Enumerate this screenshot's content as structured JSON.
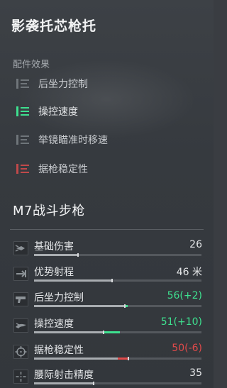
{
  "title": "影袭托芯枪托",
  "effects_label": "配件效果",
  "effects": [
    {
      "label": "后坐力控制",
      "state": "neutral",
      "icon": "stat-bars-icon"
    },
    {
      "label": "操控速度",
      "state": "up",
      "icon": "stat-bars-up-icon"
    },
    {
      "label": "举镜瞄准时移速",
      "state": "neutral",
      "icon": "stat-bars-icon"
    },
    {
      "label": "据枪稳定性",
      "state": "down",
      "icon": "stat-bars-down-icon"
    }
  ],
  "weapon_name": "M7战斗步枪",
  "stats": [
    {
      "name": "基础伤害",
      "value": "26",
      "icon": "bullet-damage-icon",
      "level": 0.26,
      "delta": 0,
      "trend": "neutral"
    },
    {
      "name": "优势射程",
      "value": "46 米",
      "icon": "range-arrow-icon",
      "level": 0.46,
      "delta": 0,
      "trend": "neutral"
    },
    {
      "name": "后坐力控制",
      "value": "56(+2)",
      "icon": "pistol-recoil-icon",
      "level": 0.56,
      "delta": 0.02,
      "trend": "up"
    },
    {
      "name": "操控速度",
      "value": "51(+10)",
      "icon": "handling-hand-icon",
      "level": 0.51,
      "delta": 0.1,
      "trend": "up"
    },
    {
      "name": "据枪稳定性",
      "value": "50(-6)",
      "icon": "crosshair-icon",
      "level": 0.5,
      "delta": -0.06,
      "trend": "down"
    },
    {
      "name": "腰际射击精度",
      "value": "35",
      "icon": "hipfire-dots-icon",
      "level": 0.35,
      "delta": 0,
      "trend": "neutral"
    }
  ],
  "colors": {
    "up": "#3ee08f",
    "down": "#e04a4a",
    "neutral_icon": "#7e8489"
  }
}
